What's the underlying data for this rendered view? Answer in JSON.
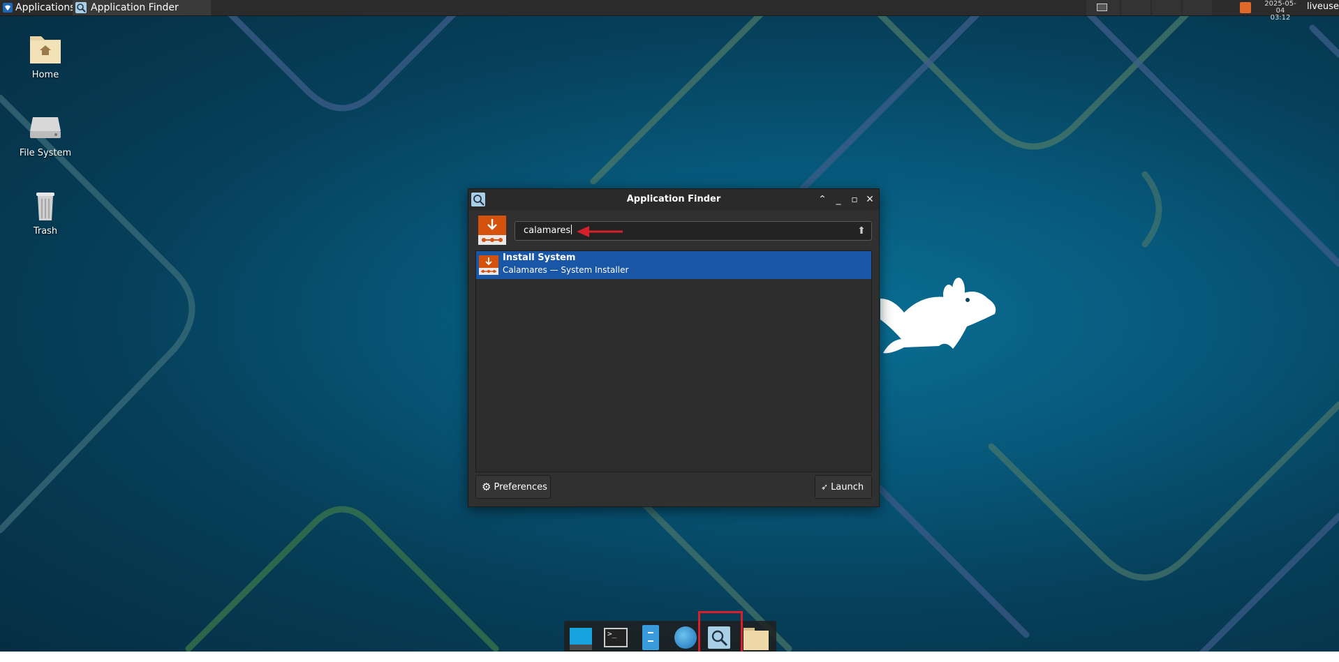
{
  "top_panel": {
    "applications_label": "Applications",
    "task_label": "Application Finder",
    "clock_date": "2025-05-04",
    "clock_time": "03:12",
    "user": "liveuser"
  },
  "desktop": {
    "icons": [
      {
        "label": "Home"
      },
      {
        "label": "File System"
      },
      {
        "label": "Trash"
      }
    ]
  },
  "dialog": {
    "title": "Application Finder",
    "search": {
      "value": "calamares"
    },
    "results": [
      {
        "name": "Install System",
        "description": "Calamares — System Installer"
      }
    ],
    "preferences_label": "Preferences",
    "launch_label": "Launch"
  },
  "colors": {
    "selection": "#1a56a6",
    "annotation_red": "#d8202a",
    "installer_orange": "#d4520d"
  },
  "dock": {
    "items": [
      "show-desktop-icon",
      "terminal-icon",
      "file-manager-icon",
      "web-browser-icon",
      "app-finder-icon",
      "folder-icon"
    ]
  }
}
